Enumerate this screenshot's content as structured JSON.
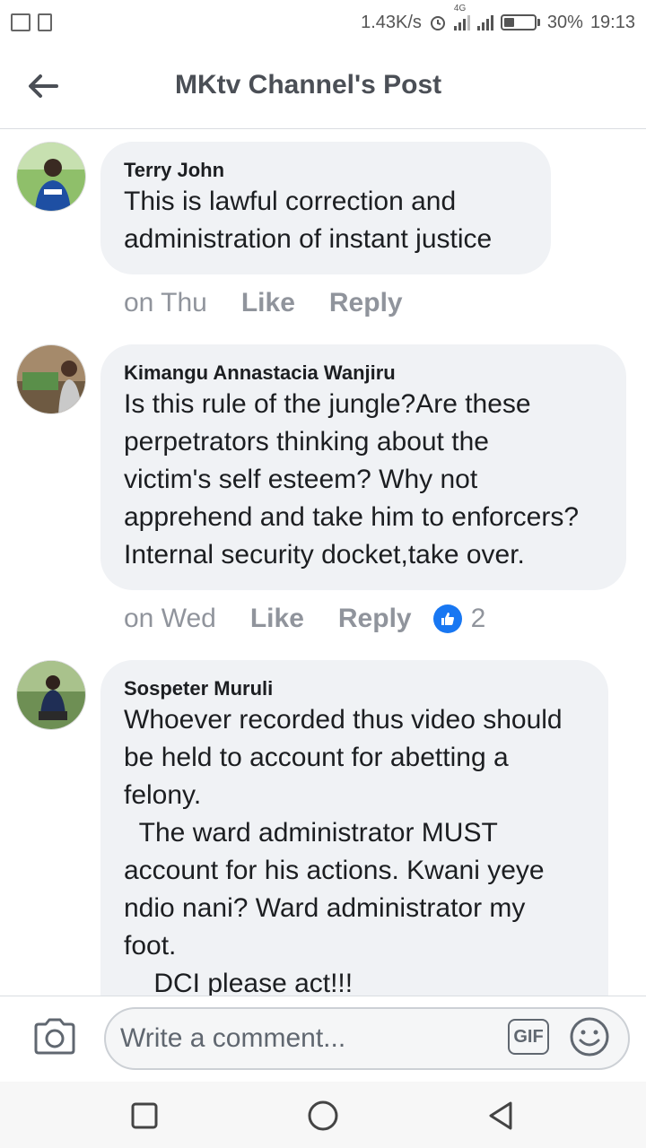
{
  "status_bar": {
    "speed": "1.43K/s",
    "network": "4G",
    "battery": "30%",
    "time": "19:13"
  },
  "header": {
    "title": "MKtv Channel's Post"
  },
  "comments": [
    {
      "author": "Terry John",
      "text": "This is lawful correction and\nadministration of instant justice",
      "time": "on Thu",
      "like_label": "Like",
      "reply_label": "Reply",
      "reactions": ""
    },
    {
      "author": "Kimangu Annastacia Wanjiru",
      "text": "Is this rule of the jungle?Are these\nperpetrators thinking about the\nvictim's self esteem? Why not\napprehend and take him to enforcers?\nInternal security docket,take over.",
      "time": "on Wed",
      "like_label": "Like",
      "reply_label": "Reply",
      "reactions": "2"
    },
    {
      "author": "Sospeter Muruli",
      "text": "Whoever recorded thus video should\nbe held to account for abetting a\nfelony.\n  The ward administrator MUST\naccount for his actions. Kwani yeye\nndio nani? Ward administrator my\nfoot.\n    DCI please act!!!",
      "time": "",
      "like_label": "",
      "reply_label": "",
      "reactions": ""
    }
  ],
  "composer": {
    "placeholder": "Write a comment...",
    "gif_label": "GIF"
  },
  "icons": {
    "back": "back-arrow-icon",
    "camera": "camera-icon",
    "emoji": "emoji-icon",
    "like": "thumbs-up-icon"
  },
  "colors": {
    "bubble": "#f0f2f5",
    "accent": "#1877f2",
    "muted": "#90949c"
  }
}
